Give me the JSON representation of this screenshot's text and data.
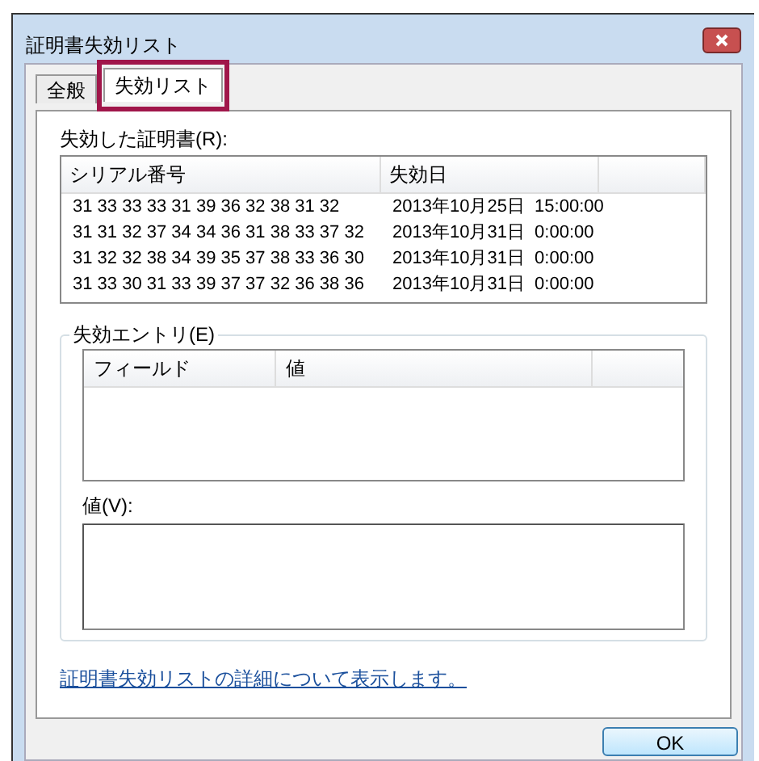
{
  "window": {
    "title": "証明書失効リスト"
  },
  "tabs": [
    {
      "label": "全般",
      "selected": false,
      "highlighted": false
    },
    {
      "label": "失効リスト",
      "selected": true,
      "highlighted": true
    }
  ],
  "revoked_certificates": {
    "label": "失効した証明書(R):",
    "columns": [
      "シリアル番号",
      "失効日"
    ],
    "rows": [
      [
        "31 33 33 33 31 39 36 32 38 31 32",
        "2013年10月25日  15:00:00"
      ],
      [
        "31 31 32 37 34 34 36 31 38 33 37 32",
        "2013年10月31日  0:00:00"
      ],
      [
        "31 32 32 38 34 39 35 37 38 33 36 30",
        "2013年10月31日  0:00:00"
      ],
      [
        "31 33 30 31 33 39 37 37 32 36 38 36",
        "2013年10月31日  0:00:00"
      ]
    ]
  },
  "revocation_entry": {
    "legend": "失効エントリ(E)",
    "columns": [
      "フィールド",
      "値"
    ],
    "value_label": "値(V):"
  },
  "link": "証明書失効リストの詳細について表示します。",
  "buttons": [
    "OK"
  ]
}
